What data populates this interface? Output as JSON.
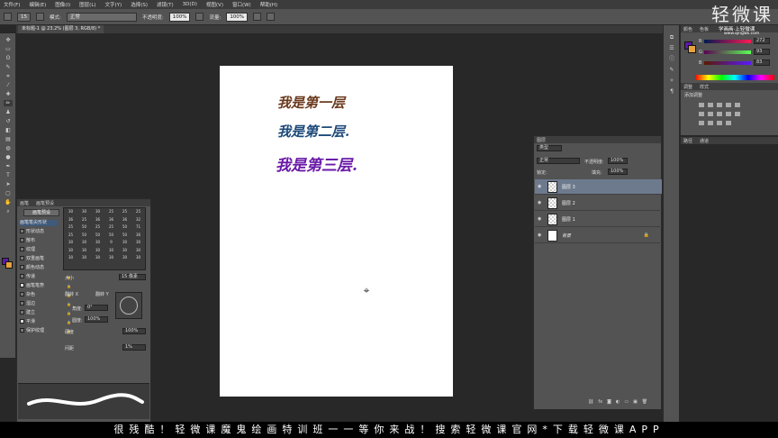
{
  "menubar": {
    "items": [
      "文件(F)",
      "编辑(E)",
      "图像(I)",
      "图层(L)",
      "文字(Y)",
      "选择(S)",
      "滤镜(T)",
      "3D(D)",
      "视图(V)",
      "窗口(W)",
      "帮助(H)"
    ]
  },
  "options": {
    "mode_label": "模式:",
    "mode_value": "正常",
    "opacity_label": "不透明度:",
    "opacity_value": "100%",
    "flow_label": "流量:",
    "flow_value": "100%",
    "brush_size": "15"
  },
  "document_tab": {
    "title": "未标题-1 @ 23.2% (图层 3, RGB/8) *"
  },
  "canvas": {
    "line1": "我是第一层",
    "line2": "我是第二层.",
    "line3": "我是第三层."
  },
  "brush_panel": {
    "tabs": [
      "画笔",
      "画笔预设"
    ],
    "presets_button": "画笔预设",
    "options": [
      {
        "label": "画笔笔尖形状",
        "checked": false
      },
      {
        "label": "形状动态",
        "checked": false
      },
      {
        "label": "散布",
        "checked": false
      },
      {
        "label": "纹理",
        "checked": false
      },
      {
        "label": "双重画笔",
        "checked": false
      },
      {
        "label": "颜色动态",
        "checked": false
      },
      {
        "label": "传递",
        "checked": false
      },
      {
        "label": "画笔笔势",
        "checked": true
      },
      {
        "label": "杂色",
        "checked": false
      },
      {
        "label": "湿边",
        "checked": false
      },
      {
        "label": "建立",
        "checked": false
      },
      {
        "label": "平滑",
        "checked": true
      },
      {
        "label": "保护纹理",
        "checked": false
      }
    ],
    "tip_sizes": [
      "30",
      "30",
      "30",
      "25",
      "25",
      "25",
      "36",
      "25",
      "36",
      "36",
      "36",
      "32",
      "25",
      "50",
      "25",
      "25",
      "50",
      "71",
      "25",
      "50",
      "50",
      "50",
      "50",
      "36",
      "30",
      "30",
      "30",
      "9",
      "30",
      "30",
      "30",
      "30",
      "30",
      "30",
      "30",
      "30",
      "30",
      "30",
      "30",
      "30",
      "30",
      "30"
    ],
    "size_label": "大小",
    "size_value": "15 像素",
    "flip_x": "翻转 X",
    "flip_y": "翻转 Y",
    "angle_label": "角度:",
    "angle_value": "0°",
    "roundness_label": "圆度:",
    "roundness_value": "100%",
    "hardness_label": "硬度",
    "hardness_value": "100%",
    "spacing_label": "间距",
    "spacing_value": "1%"
  },
  "layers_panel": {
    "tabs": [
      "图层"
    ],
    "kind_label": "类型",
    "blend_mode": "正常",
    "opacity_label": "不透明度:",
    "opacity_value": "100%",
    "lock_label": "锁定:",
    "fill_label": "填充:",
    "fill_value": "100%",
    "layers": [
      {
        "name": "图层 3",
        "selected": true
      },
      {
        "name": "图层 2",
        "selected": false
      },
      {
        "name": "图层 1",
        "selected": false
      },
      {
        "name": "背景",
        "selected": false
      }
    ]
  },
  "color_panel": {
    "tabs": [
      "颜色",
      "色板"
    ],
    "r_value": "272",
    "g_value": "93",
    "b_value": "83"
  },
  "adjust_panel": {
    "tabs": [
      "调整",
      "样式"
    ],
    "title": "添加调整"
  },
  "lib_panel": {
    "tabs": [
      "路径",
      "通道"
    ]
  },
  "watermark": {
    "logo": "轻微课",
    "subtitle": "学画画·上轻微课",
    "url": "www.qingwk.com"
  },
  "banner": {
    "text": "很残酷！轻微课魔鬼绘画特训班一一等你来战！搜索轻微课官网*下载轻微课APP"
  },
  "colors": {
    "foreground": "#5b1aa8",
    "background": "#e8a23c",
    "ink_line1": "#6b3a1e",
    "ink_line2": "#1d4a7a",
    "ink_line3": "#6a1aa8",
    "layer_selected": "#6d7a8e"
  }
}
